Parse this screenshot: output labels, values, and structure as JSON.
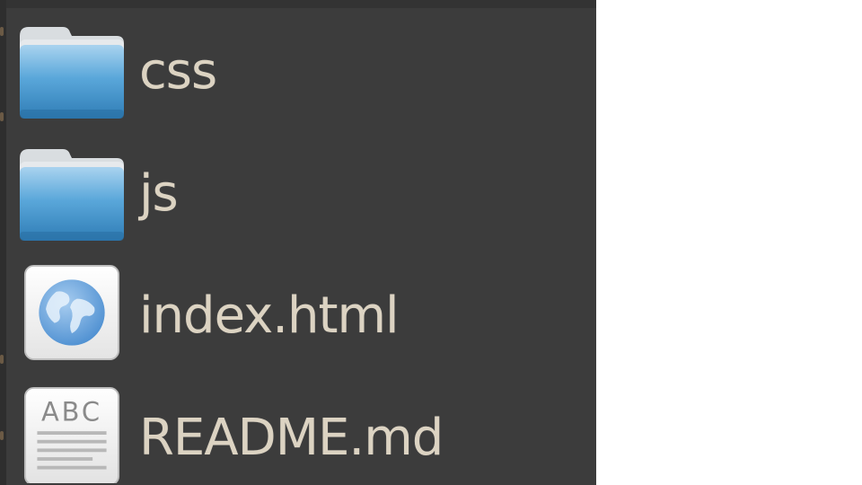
{
  "colors": {
    "pane_background": "#3c3c3c",
    "label_text": "#dcd3c2",
    "folder_blue": "#3f8fc8"
  },
  "files": [
    {
      "name": "css",
      "icon": "folder-icon"
    },
    {
      "name": "js",
      "icon": "folder-icon"
    },
    {
      "name": "index.html",
      "icon": "html-globe-icon"
    },
    {
      "name": "README.md",
      "icon": "text-document-icon"
    }
  ],
  "text_icon": {
    "letters": "ABC"
  }
}
